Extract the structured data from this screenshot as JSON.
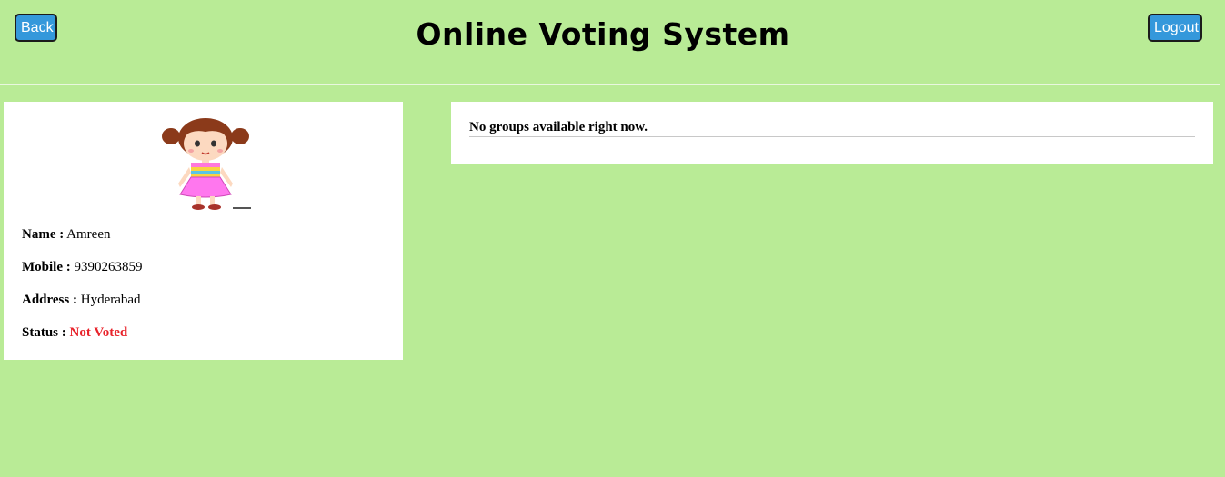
{
  "header": {
    "title": "Online Voting System",
    "back_label": "Back",
    "logout_label": "Logout"
  },
  "profile": {
    "avatar_icon": "girl-avatar-icon",
    "name_label": "Name :",
    "name_value": "Amreen",
    "mobile_label": "Mobile :",
    "mobile_value": "9390263859",
    "address_label": "Address :",
    "address_value": "Hyderabad",
    "status_label": "Status :",
    "status_value": "Not Voted"
  },
  "groups": {
    "message": "No groups available right now."
  },
  "colors": {
    "background": "#b9eb96",
    "button": "#3498db",
    "status_not_voted": "#e8222a"
  }
}
